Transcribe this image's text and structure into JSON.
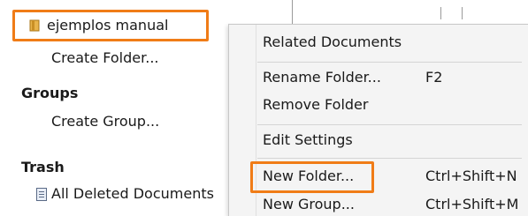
{
  "sidebar": {
    "folder_label": "ejemplos manual",
    "create_folder": "Create Folder...",
    "groups_heading": "Groups",
    "create_group": "Create Group...",
    "trash_heading": "Trash",
    "all_deleted": "All Deleted Documents"
  },
  "context_menu": {
    "related_documents": "Related Documents",
    "rename_folder": "Rename Folder...",
    "rename_shortcut": "F2",
    "remove_folder": "Remove Folder",
    "edit_settings": "Edit Settings",
    "new_folder": "New Folder...",
    "new_folder_shortcut": "Ctrl+Shift+N",
    "new_group": "New Group...",
    "new_group_shortcut": "Ctrl+Shift+M"
  },
  "colors": {
    "highlight": "#f07c17",
    "folder_icon": "#e0a83a"
  }
}
